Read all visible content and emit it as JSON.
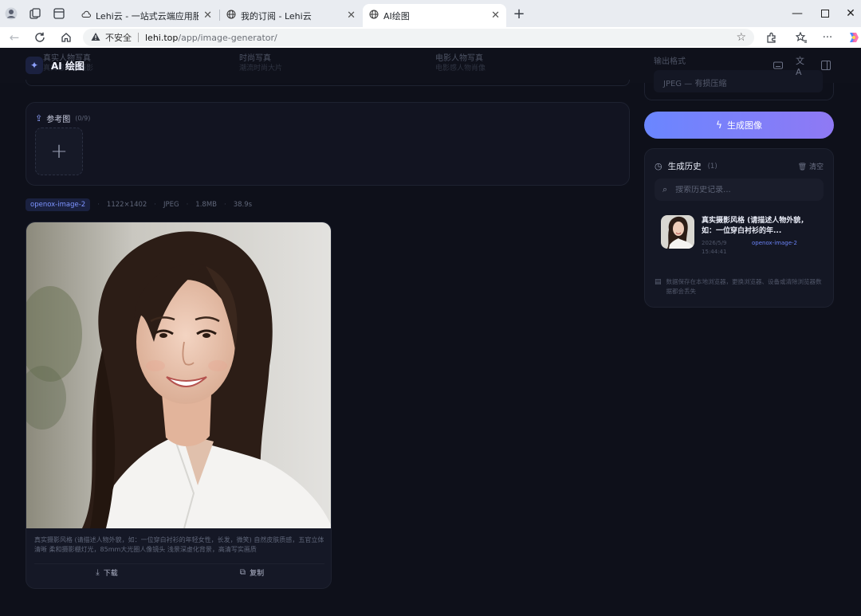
{
  "browser": {
    "tabs": [
      {
        "title": "Lehi云 - 一站式云端应用服务平台",
        "active": false
      },
      {
        "title": "我的订阅 - Lehi云",
        "active": false
      },
      {
        "title": "AI绘图",
        "active": true
      }
    ],
    "address": {
      "security_label": "不安全",
      "host": "lehi.top",
      "path": "/app/image-generator/"
    }
  },
  "app": {
    "title": "AI 绘图",
    "style_presets": [
      {
        "name": "真实人物写真",
        "desc": "真实感人像摄影"
      },
      {
        "name": "时尚写真",
        "desc": "潮流时尚大片"
      },
      {
        "name": "电影人物写真",
        "desc": "电影感人物肖像"
      }
    ],
    "output_format": {
      "label": "输出格式",
      "value": "JPEG — 有损压缩"
    },
    "reference": {
      "title": "参考图",
      "count": "(0/9)",
      "add_label": "+"
    },
    "result": {
      "model": "openox-image-2",
      "size": "1122×1402",
      "format": "JPEG",
      "filesize": "1.8MB",
      "duration": "38.9s",
      "prompt": "真实摄影风格 (请描述人物外貌，如：一位穿白衬衫的年轻女性，长发，微笑) 自然皮肤质感，五官立体清晰 柔和摄影棚灯光，85mm大光圈人像镜头 浅景深虚化背景，高清写实画质",
      "download_label": "下载",
      "copy_label": "复制"
    },
    "generate_label": "生成图像",
    "history": {
      "title": "生成历史",
      "count": "(1)",
      "clear_label": "清空",
      "search_placeholder": "搜索历史记录...",
      "items": [
        {
          "text": "真实摄影风格 (请描述人物外貌，如：一位穿白衬衫的年...",
          "date": "2026/5/9 15:44:41",
          "model": "openox-image-2"
        }
      ],
      "note": "数据保存在本地浏览器，更换浏览器、设备或清除浏览器数据都会丢失"
    }
  }
}
